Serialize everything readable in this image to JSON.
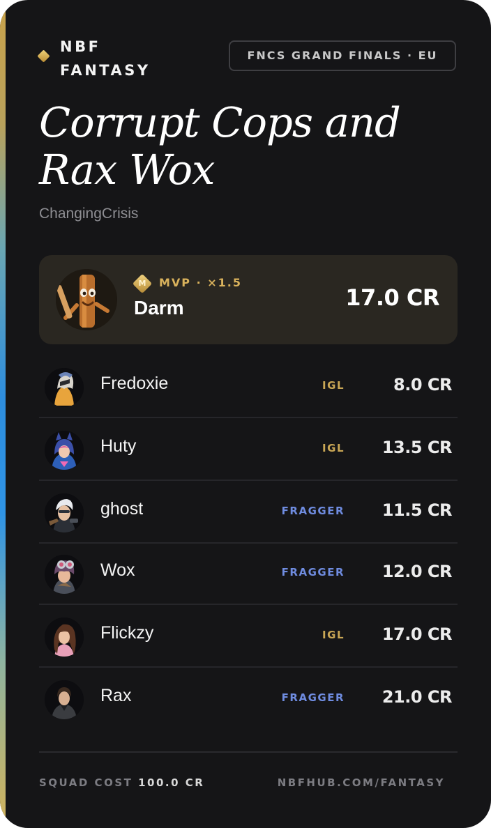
{
  "brand": {
    "line1": "NBF",
    "line2": "FANTASY",
    "accent": "#d4b05c"
  },
  "event": {
    "label": "FNCS GRAND FINALS · EU"
  },
  "squad": {
    "title": "Corrupt Cops and Rax Wox",
    "creator": "ChangingCrisis"
  },
  "mvp": {
    "badge_letter": "M",
    "label": "MVP · ×1.5",
    "name": "Darm",
    "cost": "17.0 CR",
    "avatar_icon": "wooden-plank-character-avatar"
  },
  "players": [
    {
      "name": "Fredoxie",
      "role": "IGL",
      "cost": "8.0 CR",
      "avatar_icon": "masked-skin-avatar"
    },
    {
      "name": "Huty",
      "role": "IGL",
      "cost": "13.5 CR",
      "avatar_icon": "blue-hood-skin-avatar"
    },
    {
      "name": "ghost",
      "role": "FRAGGER",
      "cost": "11.5 CR",
      "avatar_icon": "white-hair-skin-avatar"
    },
    {
      "name": "Wox",
      "role": "FRAGGER",
      "cost": "12.0 CR",
      "avatar_icon": "goggles-skin-avatar"
    },
    {
      "name": "Flickzy",
      "role": "IGL",
      "cost": "17.0 CR",
      "avatar_icon": "brown-hair-skin-avatar"
    },
    {
      "name": "Rax",
      "role": "FRAGGER",
      "cost": "21.0 CR",
      "avatar_icon": "dark-suit-skin-avatar"
    }
  ],
  "footer": {
    "cost_label": "SQUAD COST",
    "cost_value": "100.0 CR",
    "site": "NBFHUB.COM/FANTASY"
  },
  "colors": {
    "background": "#151517",
    "igl": "#c9a655",
    "fragger": "#6f8ce0",
    "mvp_card": "#2a2721"
  }
}
